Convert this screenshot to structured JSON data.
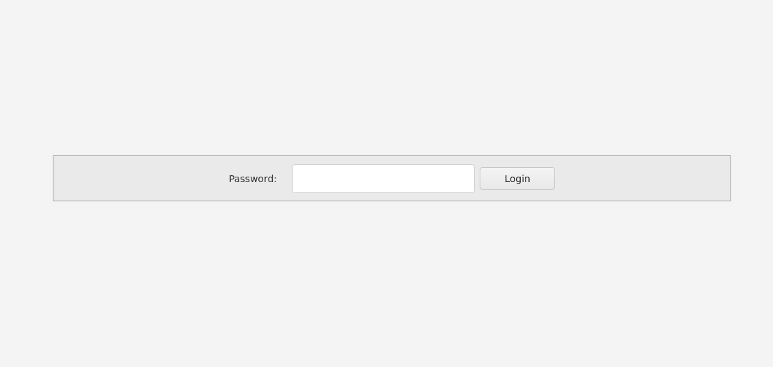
{
  "login_bar": {
    "label": "Password:",
    "button": "Login"
  }
}
